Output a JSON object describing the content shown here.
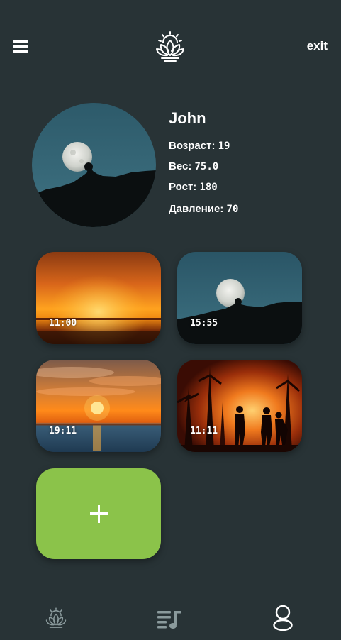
{
  "header": {
    "menu_icon": "hamburger-menu-icon",
    "logo_icon": "lotus-sunrise-logo",
    "exit_label": "exit"
  },
  "profile": {
    "name": "John",
    "avatar_icon": "moon-landscape-photo",
    "stats": [
      {
        "label": "Возраст:",
        "value": "19"
      },
      {
        "label": "Вес:",
        "value": "75.0"
      },
      {
        "label": "Рост:",
        "value": "180"
      },
      {
        "label": "Давление:",
        "value": "70"
      }
    ]
  },
  "cards": [
    {
      "time": "11:00",
      "image": "sunset-horizon-photo"
    },
    {
      "time": "15:55",
      "image": "moon-landscape-photo"
    },
    {
      "time": "19:11",
      "image": "sea-sunset-photo"
    },
    {
      "time": "11:11",
      "image": "forest-fire-people-photo"
    }
  ],
  "add_button": {
    "icon": "plus-icon",
    "color": "#8bc34a"
  },
  "bottom_nav": {
    "items": [
      "lotus-icon",
      "playlist-music-icon",
      "user-profile-icon"
    ]
  },
  "colors": {
    "background": "#283336",
    "accent": "#8bc34a"
  }
}
